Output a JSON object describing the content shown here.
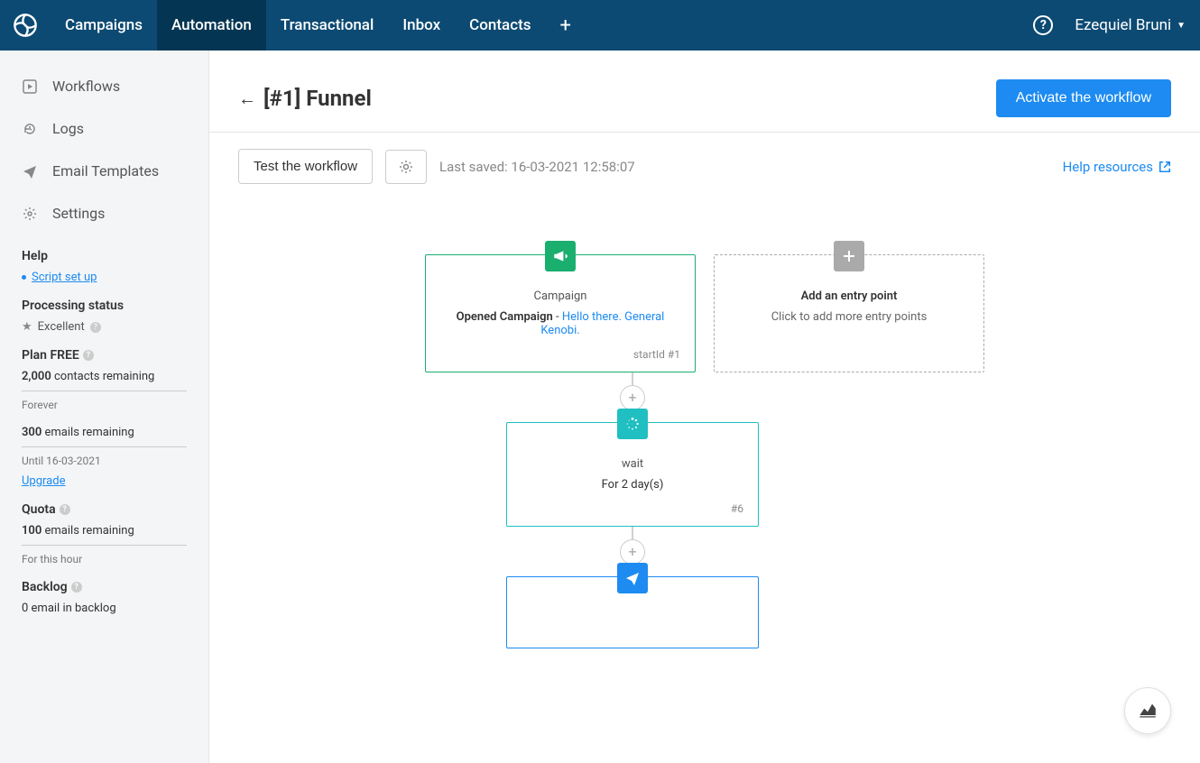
{
  "nav": {
    "tabs": [
      "Campaigns",
      "Automation",
      "Transactional",
      "Inbox",
      "Contacts"
    ],
    "user": "Ezequiel Bruni"
  },
  "sidebar": {
    "items": [
      {
        "label": "Workflows"
      },
      {
        "label": "Logs"
      },
      {
        "label": "Email Templates"
      },
      {
        "label": "Settings"
      }
    ],
    "help": {
      "heading": "Help",
      "link": "Script set up"
    },
    "processing": {
      "heading": "Processing status",
      "status": "Excellent"
    },
    "plan": {
      "heading": "Plan FREE",
      "contacts_num": "2,000",
      "contacts_label": "contacts remaining",
      "forever": "Forever",
      "emails_num": "300",
      "emails_label": "emails remaining",
      "until": "Until 16-03-2021",
      "upgrade": "Upgrade"
    },
    "quota": {
      "heading": "Quota",
      "num": "100",
      "label": "emails remaining",
      "for": "For this hour"
    },
    "backlog": {
      "heading": "Backlog",
      "text": "0 email in backlog"
    }
  },
  "header": {
    "title": "[#1] Funnel",
    "activate": "Activate the workflow"
  },
  "toolbar": {
    "test": "Test the workflow",
    "last_saved": "Last saved: 16-03-2021 12:58:07",
    "help": "Help resources"
  },
  "flow": {
    "campaign": {
      "title": "Campaign",
      "opened": "Opened Campaign",
      "dash": " - ",
      "link": "Hello there. General Kenobi.",
      "footer": "startId #1"
    },
    "add_entry": {
      "title": "Add an entry point",
      "sub": "Click to add more entry points"
    },
    "wait": {
      "title": "wait",
      "body": "For 2 day(s)",
      "footer": "#6"
    }
  }
}
